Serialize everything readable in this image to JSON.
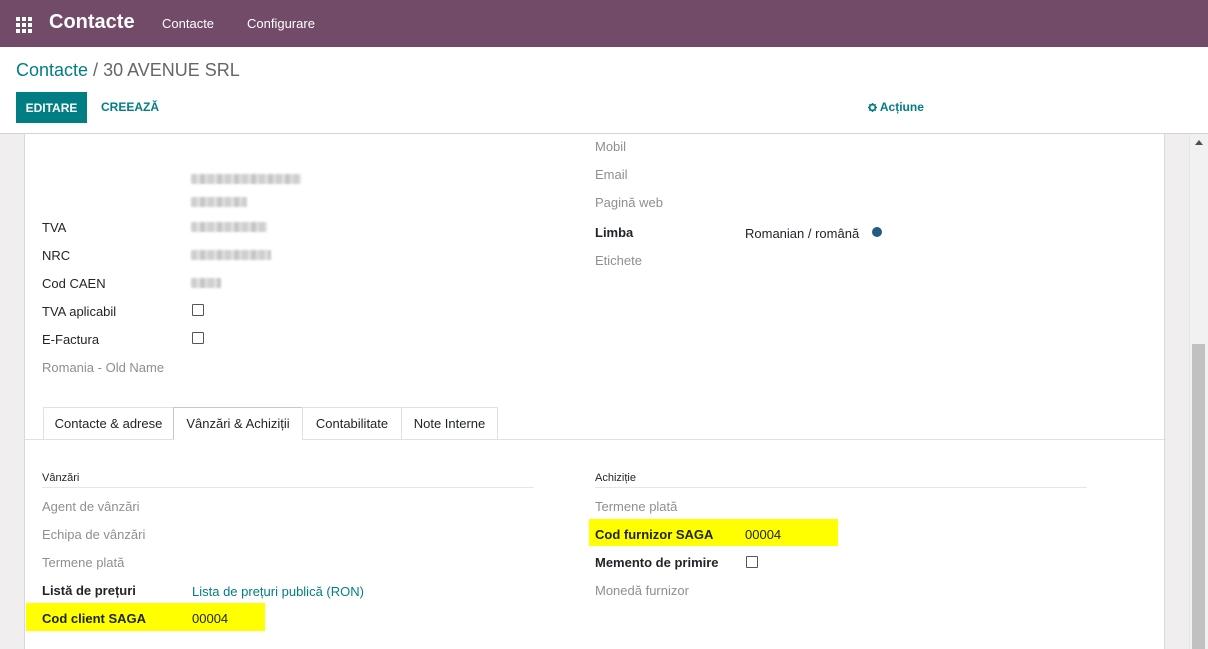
{
  "app": {
    "title": "Contacte",
    "menu": [
      "Contacte",
      "Configurare"
    ]
  },
  "breadcrumb": {
    "parent": "Contacte",
    "separator": " / ",
    "current": "30 AVENUE SRL"
  },
  "toolbar": {
    "edit_label": "EDITARE",
    "create_label": "CREEAZĂ",
    "actions_label": "Acțiune",
    "actions_icon": "gear-icon"
  },
  "left_fields": {
    "tva": "TVA",
    "nrc": "NRC",
    "cod_caen": "Cod CAEN",
    "tva_aplicabil": "TVA aplicabil",
    "e_factura": "E-Factura",
    "old_name": "Romania - Old Name"
  },
  "right_fields": {
    "mobil": "Mobil",
    "email": "Email",
    "pagina_web": "Pagină web",
    "limba": "Limba",
    "limba_value": "Romanian / română",
    "etichete": "Etichete"
  },
  "tabs": [
    "Contacte & adrese",
    "Vânzări & Achiziții",
    "Contabilitate",
    "Note Interne"
  ],
  "active_tab": "Vânzări & Achiziții",
  "sales": {
    "title": "Vânzări",
    "agent": "Agent de vânzări",
    "echipa": "Echipa de vânzări",
    "termene": "Termene plată",
    "lista_preturi": "Listă de prețuri",
    "lista_preturi_value": "Lista de prețuri publică (RON)",
    "cod_client": "Cod client SAGA",
    "cod_client_value": "00004"
  },
  "purchase": {
    "title": "Achiziție",
    "termene": "Termene plată",
    "cod_furnizor": "Cod furnizor SAGA",
    "cod_furnizor_value": "00004",
    "memento": "Memento de primire",
    "moneda": "Monedă furnizor"
  },
  "colors": {
    "navbar": "#714b67",
    "primary": "#017e84",
    "highlight": "#ffff00"
  }
}
